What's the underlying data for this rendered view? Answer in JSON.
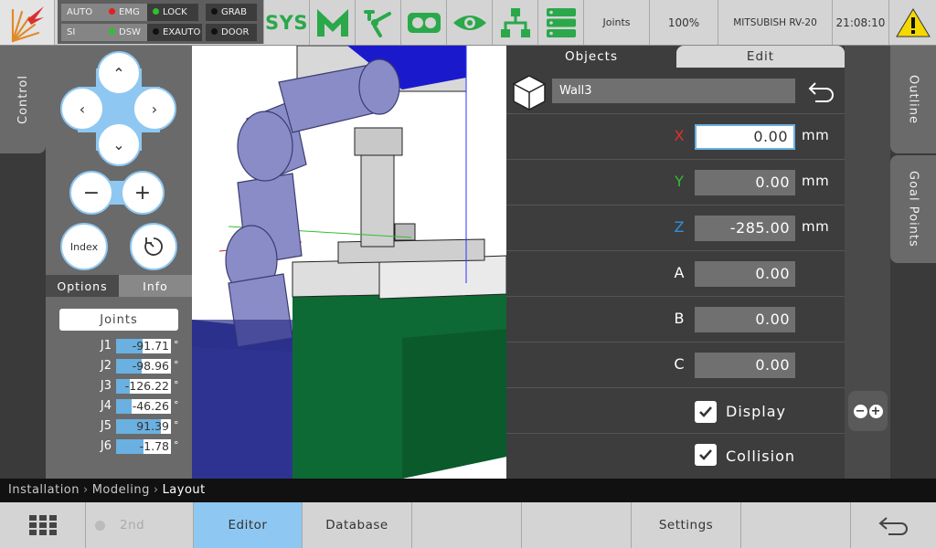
{
  "topbar": {
    "status": {
      "auto": "AUTO",
      "si": "SI",
      "emg": "EMG",
      "dsw": "DSW",
      "lock": "LOCK",
      "exauto": "EXAUTO",
      "grab": "GRAB",
      "door": "DOOR"
    },
    "sys_label": "SYS",
    "mode": "Joints",
    "speed": "100%",
    "robot_model": "MITSUBISH RV-20",
    "time": "21:08:10"
  },
  "left_tab": "Control",
  "right_tabs": [
    "Outline",
    "Goal Points"
  ],
  "control": {
    "index_label": "Index",
    "tabs": [
      "Options",
      "Info"
    ],
    "joints_button": "Joints",
    "joints": [
      {
        "name": "J1",
        "value": "-91.71",
        "level": 0.48
      },
      {
        "name": "J2",
        "value": "-98.96",
        "level": 0.46
      },
      {
        "name": "J3",
        "value": "-126.22",
        "level": 0.25
      },
      {
        "name": "J4",
        "value": "-46.26",
        "level": 0.28
      },
      {
        "name": "J5",
        "value": "91.39",
        "level": 0.82
      },
      {
        "name": "J6",
        "value": "-1.78",
        "level": 0.5
      }
    ],
    "deg_unit": "°"
  },
  "panel": {
    "tabs": [
      "Objects",
      "Edit"
    ],
    "object_name": "Wall3",
    "fields": [
      {
        "label": "X",
        "value": "0.00",
        "unit": "mm",
        "color": "#e03030"
      },
      {
        "label": "Y",
        "value": "0.00",
        "unit": "mm",
        "color": "#30c030"
      },
      {
        "label": "Z",
        "value": "-285.00",
        "unit": "mm",
        "color": "#3090e0"
      },
      {
        "label": "A",
        "value": "0.00",
        "unit": "",
        "color": "#ffffff"
      },
      {
        "label": "B",
        "value": "0.00",
        "unit": "",
        "color": "#ffffff"
      },
      {
        "label": "C",
        "value": "0.00",
        "unit": "",
        "color": "#ffffff"
      }
    ],
    "display_label": "Display",
    "collision_label": "Collision"
  },
  "breadcrumb": [
    "Installation",
    "Modeling",
    "Layout"
  ],
  "bottombar": {
    "second": "2nd",
    "editor": "Editor",
    "database": "Database",
    "settings": "Settings"
  },
  "colors": {
    "accent": "#8ec8f2",
    "sys_green": "#2aa84a",
    "warning": "#f5d800"
  }
}
